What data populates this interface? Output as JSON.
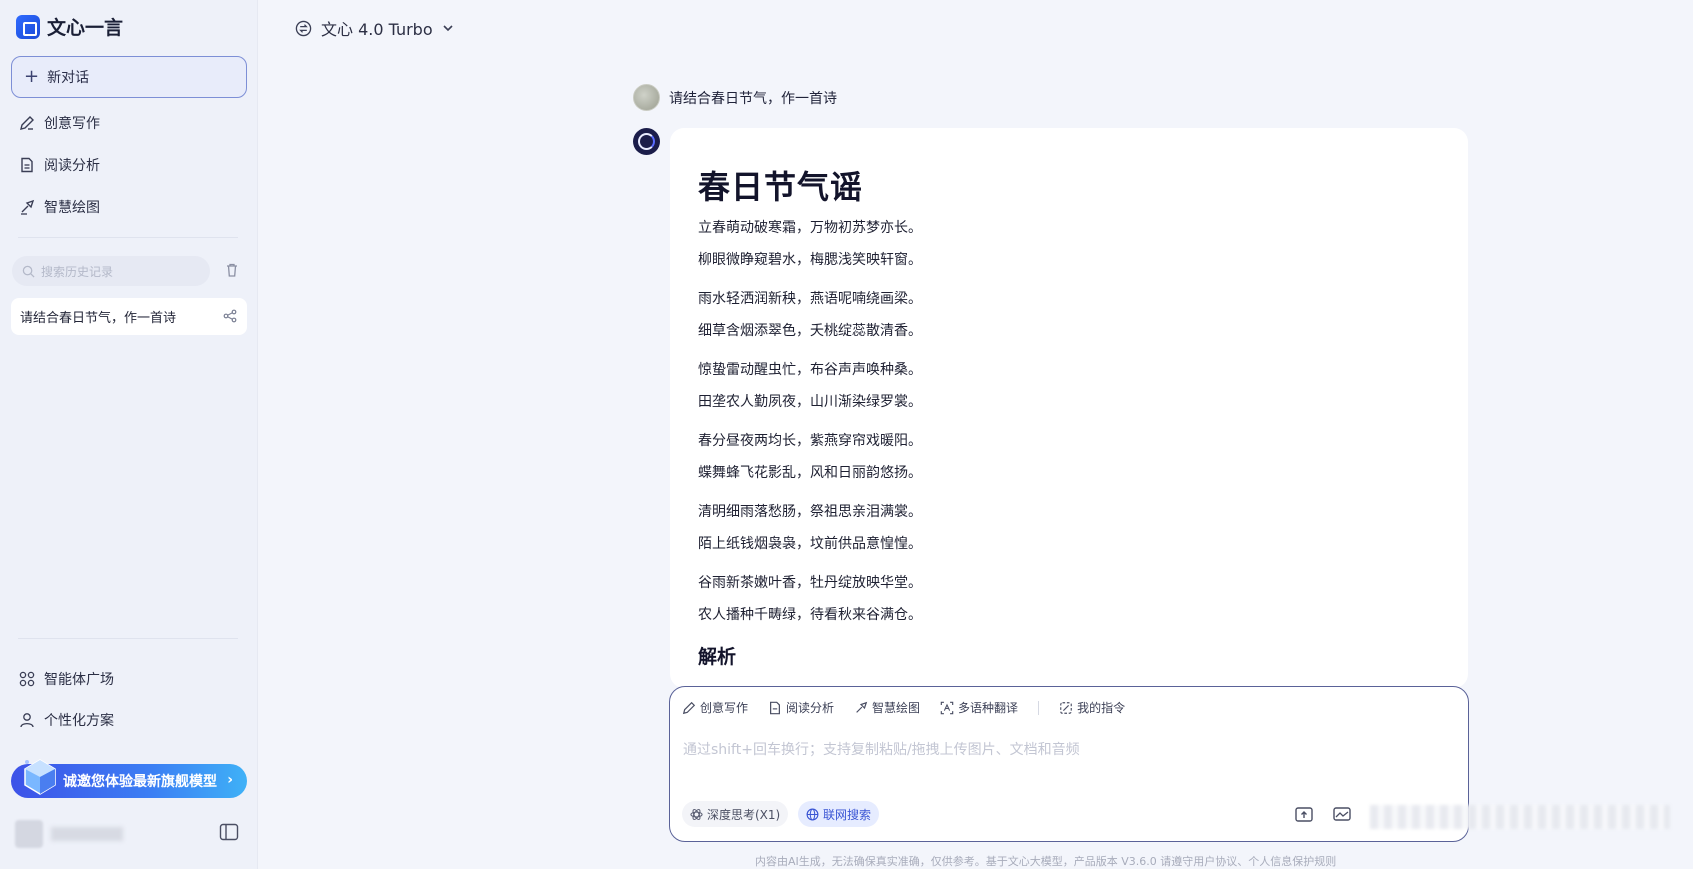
{
  "app": {
    "name": "文心一言"
  },
  "sidebar": {
    "new_chat": "新对话",
    "nav": [
      {
        "label": "创意写作",
        "icon": "pen-icon"
      },
      {
        "label": "阅读分析",
        "icon": "document-icon"
      },
      {
        "label": "智慧绘图",
        "icon": "brush-icon"
      }
    ],
    "search_placeholder": "搜索历史记录",
    "history": [
      {
        "title": "请结合春日节气，作一首诗"
      }
    ],
    "bottom_nav": [
      {
        "label": "智能体广场",
        "icon": "grid-icon"
      },
      {
        "label": "个性化方案",
        "icon": "user-icon"
      }
    ],
    "promo": "诚邀您体验最新旗舰模型"
  },
  "header": {
    "model": "文心 4.0 Turbo"
  },
  "conversation": {
    "user_message": "请结合春日节气，作一首诗",
    "answer": {
      "title": "春日节气谣",
      "lines": [
        "立春萌动破寒霜，万物初苏梦亦长。",
        "柳眼微睁窥碧水，梅腮浅笑映轩窗。",
        "雨水轻洒润新秧，燕语呢喃绕画梁。",
        "细草含烟添翠色，夭桃绽蕊散清香。",
        "惊蛰雷动醒虫忙，布谷声声唤种桑。",
        "田垄农人勤夙夜，山川渐染绿罗裳。",
        "春分昼夜两均长，紫燕穿帘戏暖阳。",
        "蝶舞蜂飞花影乱，风和日丽韵悠扬。",
        "清明细雨落愁肠，祭祖思亲泪满裳。",
        "陌上纸钱烟袅袅，坟前供品意惶惶。",
        "谷雨新茶嫩叶香，牡丹绽放映华堂。",
        "农人播种千畴绿，待看秋来谷满仓。"
      ],
      "section_heading": "解析"
    }
  },
  "input": {
    "tools": [
      {
        "label": "创意写作",
        "icon": "pen-icon"
      },
      {
        "label": "阅读分析",
        "icon": "document-icon"
      },
      {
        "label": "智慧绘图",
        "icon": "brush-icon"
      },
      {
        "label": "多语种翻译",
        "icon": "translate-icon"
      },
      {
        "label": "我的指令",
        "icon": "command-icon"
      }
    ],
    "placeholder": "通过shift+回车换行；支持复制粘贴/拖拽上传图片、文档和音频",
    "chips": {
      "deep_think": "深度思考(X1)",
      "web_search": "联网搜索"
    }
  },
  "footer": "内容由AI生成，无法确保真实准确，仅供参考。基于文心大模型，产品版本 V3.6.0 请遵守用户协议、个人信息保护规则"
}
